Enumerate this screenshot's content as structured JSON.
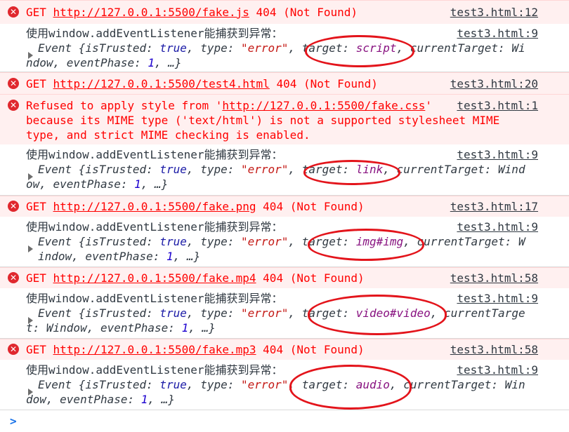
{
  "entries": [
    {
      "type": "error",
      "lines": [
        "GET http://127.0.0.1:5500/fake.js 404 (Not Found)"
      ],
      "method": "GET",
      "url": "http://127.0.0.1:5500/fake.js",
      "status": "404 (Not Found)",
      "source": "test3.html:12"
    },
    {
      "type": "log",
      "message": "使用window.addEventListener能捕获到异常：",
      "source": "test3.html:9",
      "obj_line1": [
        "Event {",
        "isTrusted",
        ": ",
        "true",
        ", ",
        "type",
        ": ",
        "\"error\"",
        ", ",
        "target",
        ": ",
        "script",
        ", ",
        "currentTarget",
        ": Wi"
      ],
      "obj_line2": [
        "ndow, ",
        "eventPhase",
        ": ",
        "1",
        ", …}"
      ],
      "target": "script"
    },
    {
      "type": "error",
      "method": "GET",
      "url": "http://127.0.0.1:5500/test4.html",
      "status": "404 (Not Found)",
      "source": "test3.html:20"
    },
    {
      "type": "error-multi",
      "line1_prefix": "Refused to apply style from '",
      "line1_url": "http://127.0.0.1:5500/fake.css",
      "line1_suffix": "'",
      "line2": "because its MIME type ('text/html') is not a supported stylesheet MIME",
      "line3": "type, and strict MIME checking is enabled.",
      "source": "test3.html:1"
    },
    {
      "type": "log",
      "message": "使用window.addEventListener能捕获到异常：",
      "source": "test3.html:9",
      "obj_line1_a": "Event {isTrusted: ",
      "obj_line1_b": "true",
      "obj_line1_c": ", type: ",
      "obj_line1_d": "\"error\"",
      "obj_line1_e": ", target: ",
      "obj_line1_f": "link",
      "obj_line1_g": ", currentTarget: Wind",
      "obj_line2_a": "ow, eventPhase: ",
      "obj_line2_b": "1",
      "obj_line2_c": ", …}"
    },
    {
      "type": "error",
      "method": "GET",
      "url": "http://127.0.0.1:5500/fake.png",
      "status": "404 (Not Found)",
      "source": "test3.html:17"
    },
    {
      "type": "log",
      "message": "使用window.addEventListener能捕获到异常：",
      "source": "test3.html:9",
      "obj_line1_a": "Event {isTrusted: ",
      "obj_line1_b": "true",
      "obj_line1_c": ", type: ",
      "obj_line1_d": "\"error\"",
      "obj_line1_e": ", target: ",
      "obj_line1_f": "img#img",
      "obj_line1_g": ", currentTarget: W",
      "obj_line2_a": "indow, eventPhase: ",
      "obj_line2_b": "1",
      "obj_line2_c": ", …}"
    },
    {
      "type": "error",
      "method": "GET",
      "url": "http://127.0.0.1:5500/fake.mp4",
      "status": "404 (Not Found)",
      "source": "test3.html:58"
    },
    {
      "type": "log",
      "message": "使用window.addEventListener能捕获到异常：",
      "source": "test3.html:9",
      "obj_line1_a": "Event {isTrusted: ",
      "obj_line1_b": "true",
      "obj_line1_c": ", type: ",
      "obj_line1_d": "\"error\"",
      "obj_line1_e": ", target: ",
      "obj_line1_f": "video#video",
      "obj_line1_g": ", currentTarge",
      "obj_line2_a": "t: Window, eventPhase: ",
      "obj_line2_b": "1",
      "obj_line2_c": ", …}"
    },
    {
      "type": "error",
      "method": "GET",
      "url": "http://127.0.0.1:5500/fake.mp3",
      "status": "404 (Not Found)",
      "source": "test3.html:58"
    },
    {
      "type": "log",
      "message": "使用window.addEventListener能捕获到异常：",
      "source": "test3.html:9",
      "obj_line1_a": "Event {isTrusted: ",
      "obj_line1_b": "true",
      "obj_line1_c": ", type: ",
      "obj_line1_d": "\"error\"",
      "obj_line1_e": ", target: ",
      "obj_line1_f": "audio",
      "obj_line1_g": ", currentTarget: Win",
      "obj_line2_a": "dow, eventPhase: ",
      "obj_line2_b": "1",
      "obj_line2_c": ", …}"
    }
  ],
  "prompt_symbol": ">",
  "colors": {
    "error_bg": "#fff0f0",
    "error_text": "#ff0000",
    "annotation_red": "#e3141b",
    "prompt_blue": "#1a73e8"
  }
}
